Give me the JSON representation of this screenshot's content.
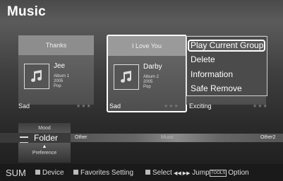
{
  "title": "Music",
  "cards": [
    {
      "song": "Thanks",
      "artist": "Jee",
      "album": "Album 1",
      "year": "2005",
      "genre": "Pop",
      "mood": "Sad",
      "stars": "★★★"
    },
    {
      "song": "I Love You",
      "artist": "Darby",
      "album": "Album 2",
      "year": "2005",
      "genre": "Pop",
      "mood": "Sad",
      "stars": "★★★"
    },
    {
      "mood": "Exciting",
      "stars": "★★★"
    }
  ],
  "context_menu": {
    "items": [
      "Play Current Group",
      "Delete",
      "Information",
      "Safe Remove"
    ],
    "selected_index": 0
  },
  "filter_bar": {
    "mood_tab": "Mood",
    "current": "Folder",
    "preference_tab": "Preference",
    "items": [
      "Other",
      "Music",
      "Other2"
    ]
  },
  "footer": {
    "brand": "SUM",
    "device": "Device",
    "favorites": "Favorites Setting",
    "select": "Select",
    "jump_arrows": "◀◀ ▶▶",
    "jump": "Jump",
    "tools": "TOOLS",
    "option": "Option"
  },
  "colors": {
    "selection_border": "#ffffff",
    "menu_bg": "#4b4b4b"
  }
}
